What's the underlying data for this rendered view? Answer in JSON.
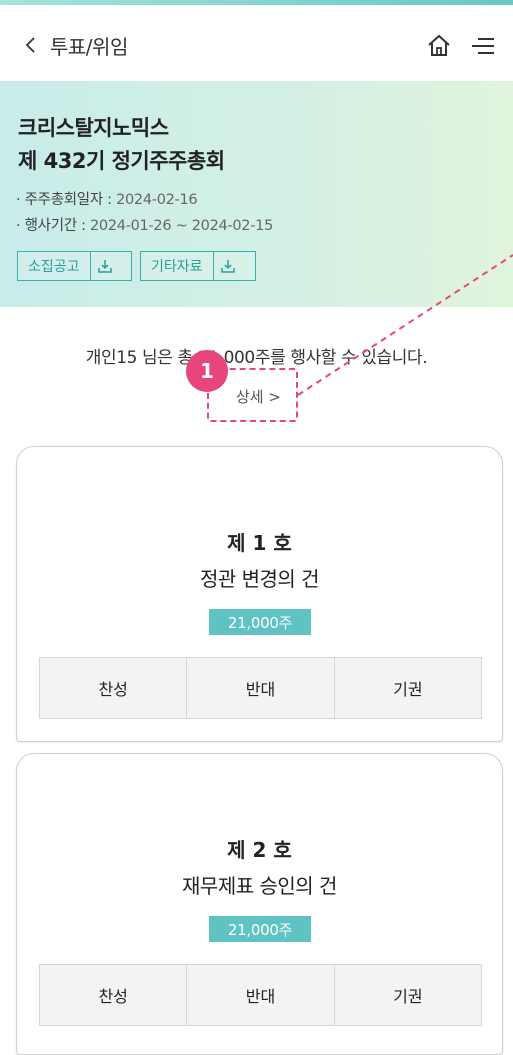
{
  "header": {
    "back_label": "투표/위임",
    "icons": [
      "home-icon",
      "menu-icon"
    ]
  },
  "meeting": {
    "company": "크리스탈지노믹스",
    "title": "제 432기 정기주주총회",
    "date_label": "· 주주총회일자 :",
    "date_value": "2024-02-16",
    "period_label": "· 행사기간 :",
    "period_value": "2024-01-26 ~ 2024-02-15",
    "docs": [
      {
        "label": "소집공고"
      },
      {
        "label": "기타자료"
      }
    ]
  },
  "summary": {
    "text": "개인15 님은 총 21,000주를 행사할 수 있습니다.",
    "detail": "상세 >",
    "badge": "1"
  },
  "items": [
    {
      "no": "제 1 호",
      "title": "정관 변경의 건",
      "shares": "21,000주",
      "options": [
        "찬성",
        "반대",
        "기권"
      ]
    },
    {
      "no": "제 2 호",
      "title": "재무제표 승인의 건",
      "shares": "21,000주",
      "options": [
        "찬성",
        "반대",
        "기권"
      ]
    }
  ],
  "colors": {
    "accent": "#5fc3c4",
    "highlight": "#e8447d"
  }
}
